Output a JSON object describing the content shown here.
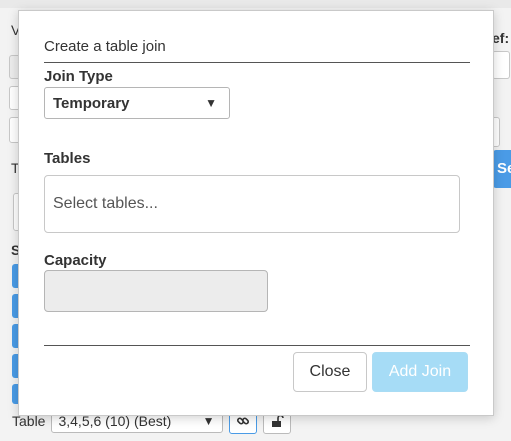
{
  "background": {
    "left_fragment": "V",
    "right_fragment": "ef:",
    "t_fragment": "T",
    "s_fragment": "S",
    "blue_button_label": "Se",
    "bottom": {
      "label": "Table",
      "select_value": "3,4,5,6 (10) (Best)",
      "link_icon": "link-icon",
      "lock_icon": "unlock-icon"
    }
  },
  "modal": {
    "title": "Create a table join",
    "join_type": {
      "label": "Join Type",
      "selected": "Temporary"
    },
    "tables": {
      "label": "Tables",
      "placeholder": "Select tables..."
    },
    "capacity": {
      "label": "Capacity",
      "value": ""
    },
    "buttons": {
      "close": "Close",
      "add_join": "Add Join"
    }
  },
  "colors": {
    "accent_blue": "#4a9be6",
    "disabled_button": "#a6dcf6"
  }
}
